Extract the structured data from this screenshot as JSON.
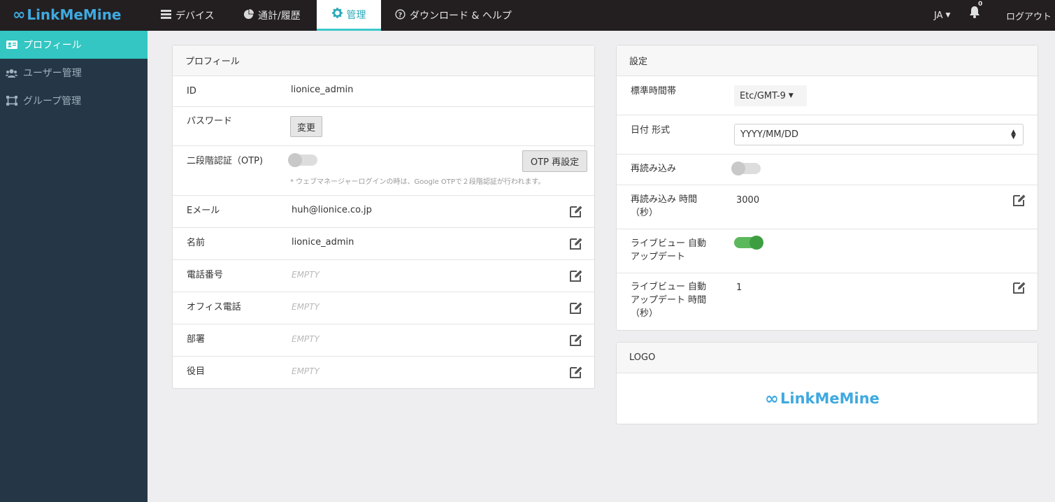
{
  "brand": {
    "name": "LinkMeMine",
    "symbol": "∞"
  },
  "nav": {
    "devices": {
      "label": "デバイス",
      "icon": "server-icon"
    },
    "stats": {
      "label": "通計/履歴",
      "icon": "pie-chart-icon"
    },
    "admin": {
      "label": "管理",
      "icon": "gear-icon"
    },
    "help": {
      "label": "ダウンロード & ヘルプ",
      "icon": "question-circle-icon"
    }
  },
  "header_right": {
    "lang": "JA",
    "notifications": "0",
    "logout": "ログアウト"
  },
  "sidebar": {
    "items": [
      {
        "label": "プロフィール",
        "icon": "id-card-icon",
        "active": true
      },
      {
        "label": "ユーザー管理",
        "icon": "users-icon",
        "active": false
      },
      {
        "label": "グループ管理",
        "icon": "group-icon",
        "active": false
      }
    ]
  },
  "profile": {
    "title": "プロフィール",
    "id_label": "ID",
    "id_value": "lionice_admin",
    "password_label": "パスワード",
    "password_button": "変更",
    "otp_label": "二段階認証（OTP)",
    "otp_enabled": false,
    "otp_reset_button": "OTP 再設定",
    "otp_note": "* ウェブマネージャーログインの時は、Google OTPで２段階認証が行われます。",
    "email_label": "Eメール",
    "email_value": "huh@lionice.co.jp",
    "name_label": "名前",
    "name_value": "lionice_admin",
    "phone_label": "電話番号",
    "phone_value": "EMPTY",
    "office_label": "オフィス電話",
    "office_value": "EMPTY",
    "dept_label": "部署",
    "dept_value": "EMPTY",
    "role_label": "役目",
    "role_value": "EMPTY"
  },
  "settings": {
    "title": "設定",
    "timezone_label": "標準時間帯",
    "timezone_value": "Etc/GMT-9",
    "date_format_label": "日付 形式",
    "date_format_value": "YYYY/MM/DD",
    "reload_label": "再読み込み",
    "reload_enabled": false,
    "reload_time_label_1": "再読み込み 時間",
    "reload_time_label_2": "（秒）",
    "reload_time_value": "3000",
    "liveview_label_1": "ライブビュー 自動",
    "liveview_label_2": "アップデート",
    "liveview_enabled": true,
    "liveview_time_label_1": "ライブビュー 自動",
    "liveview_time_label_2": "アップデート 時間",
    "liveview_time_label_3": "（秒）",
    "liveview_time_value": "1"
  },
  "logo_panel": {
    "title": "LOGO",
    "logo_text": "LinkMeMine",
    "logo_symbol": "∞"
  },
  "colors": {
    "accent": "#33c6c2",
    "brand": "#3fa9e0",
    "topbar": "#231f20",
    "sidebar": "#253746",
    "toggle_on": "#5cb85c"
  }
}
